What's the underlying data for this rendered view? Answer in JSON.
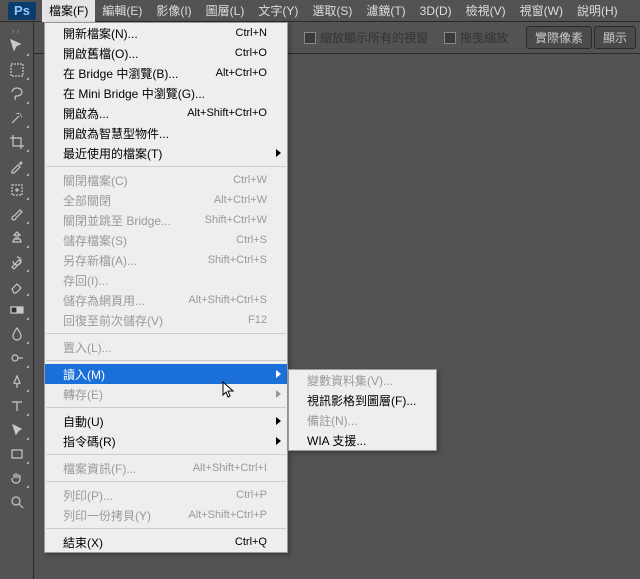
{
  "app": {
    "logo": "Ps"
  },
  "menubar": [
    {
      "label": "檔案(F)",
      "open": true
    },
    {
      "label": "編輯(E)"
    },
    {
      "label": "影像(I)"
    },
    {
      "label": "圖層(L)"
    },
    {
      "label": "文字(Y)"
    },
    {
      "label": "選取(S)"
    },
    {
      "label": "濾鏡(T)"
    },
    {
      "label": "3D(D)"
    },
    {
      "label": "檢視(V)"
    },
    {
      "label": "視窗(W)"
    },
    {
      "label": "說明(H)"
    }
  ],
  "optbar": {
    "chk1": "縮放顯示所有的視窗",
    "chk2": "拖曳縮放",
    "btn1": "實際像素",
    "btn2": "顯示"
  },
  "file_menu": [
    {
      "label": "開新檔案(N)...",
      "shortcut": "Ctrl+N"
    },
    {
      "label": "開啟舊檔(O)...",
      "shortcut": "Ctrl+O"
    },
    {
      "label": "在 Bridge 中瀏覽(B)...",
      "shortcut": "Alt+Ctrl+O"
    },
    {
      "label": "在 Mini Bridge 中瀏覽(G)..."
    },
    {
      "label": "開啟為...",
      "shortcut": "Alt+Shift+Ctrl+O"
    },
    {
      "label": "開啟為智慧型物件..."
    },
    {
      "label": "最近使用的檔案(T)",
      "sub": true
    },
    {
      "sep": true
    },
    {
      "label": "關閉檔案(C)",
      "shortcut": "Ctrl+W",
      "dis": true
    },
    {
      "label": "全部關閉",
      "shortcut": "Alt+Ctrl+W",
      "dis": true
    },
    {
      "label": "關閉並跳至 Bridge...",
      "shortcut": "Shift+Ctrl+W",
      "dis": true
    },
    {
      "label": "儲存檔案(S)",
      "shortcut": "Ctrl+S",
      "dis": true
    },
    {
      "label": "另存新檔(A)...",
      "shortcut": "Shift+Ctrl+S",
      "dis": true
    },
    {
      "label": "存回(I)...",
      "dis": true
    },
    {
      "label": "儲存為網頁用...",
      "shortcut": "Alt+Shift+Ctrl+S",
      "dis": true
    },
    {
      "label": "回復至前次儲存(V)",
      "shortcut": "F12",
      "dis": true
    },
    {
      "sep": true
    },
    {
      "label": "置入(L)...",
      "dis": true
    },
    {
      "sep": true
    },
    {
      "label": "讀入(M)",
      "sub": true,
      "hi": true
    },
    {
      "label": "轉存(E)",
      "sub": true,
      "dis": true
    },
    {
      "sep": true
    },
    {
      "label": "自動(U)",
      "sub": true
    },
    {
      "label": "指令碼(R)",
      "sub": true
    },
    {
      "sep": true
    },
    {
      "label": "檔案資訊(F)...",
      "shortcut": "Alt+Shift+Ctrl+I",
      "dis": true
    },
    {
      "sep": true
    },
    {
      "label": "列印(P)...",
      "shortcut": "Ctrl+P",
      "dis": true
    },
    {
      "label": "列印一份拷貝(Y)",
      "shortcut": "Alt+Shift+Ctrl+P",
      "dis": true
    },
    {
      "sep": true
    },
    {
      "label": "結束(X)",
      "shortcut": "Ctrl+Q"
    }
  ],
  "import_menu": [
    {
      "label": "變數資料集(V)...",
      "dis": true
    },
    {
      "label": "視訊影格到圖層(F)..."
    },
    {
      "label": "備註(N)...",
      "dis": true
    },
    {
      "label": "WIA 支援..."
    }
  ]
}
